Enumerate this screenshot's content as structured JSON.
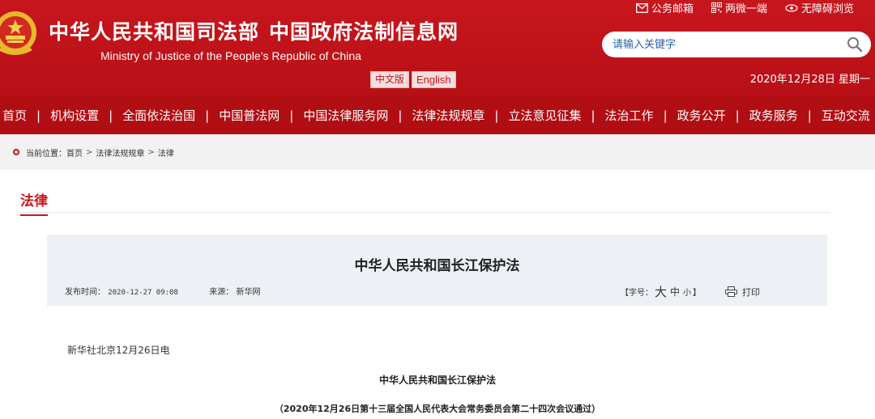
{
  "header": {
    "title_cn_1": "中华人民共和国司法部",
    "title_cn_2": "中国政府法制信息网",
    "subtitle_en": "Ministry of Justice of the People’s Republic of China",
    "lang_cn": "中文版",
    "lang_en": "English",
    "date_text": "2020年12月28日 星期一",
    "top_links": [
      {
        "label": "公务邮箱",
        "icon": "mail-icon"
      },
      {
        "label": "两微一端",
        "icon": "qr-code-icon"
      },
      {
        "label": "无障碍浏览",
        "icon": "eye-icon"
      }
    ]
  },
  "search": {
    "placeholder": "请输入关键字",
    "icon": "search-icon"
  },
  "nav": {
    "items": [
      "首页",
      "机构设置",
      "全面依法治国",
      "中国普法网",
      "中国法律服务网",
      "法律法规规章",
      "立法意见征集",
      "法治工作",
      "政务公开",
      "政务服务",
      "互动交流"
    ]
  },
  "breadcrumb": {
    "prefix": "当前位置：",
    "items": [
      "首页",
      "法律法规规章",
      "法律"
    ],
    "separator": ">"
  },
  "section": {
    "title": "法律"
  },
  "article": {
    "title": "中华人民共和国长江保护法",
    "publish_label": "发布时间：",
    "publish_time": "2020-12-27 09:08",
    "source_label": "来源：",
    "source": "新华网",
    "font_size_label": "【字号：",
    "font_size_end": "】",
    "font_big": "大",
    "font_mid": "中",
    "font_small": "小",
    "print_label": "打印"
  },
  "content": {
    "dateline": "新华社北京12月26日电",
    "title": "中华人民共和国长江保护法",
    "subtitle": "（2020年12月26日第十三届全国人民代表大会常务委员会第二十四次会议通过）"
  },
  "colors": {
    "brand_red": "#c8161d",
    "nav_red": "#b10e14",
    "card_bg": "#edf0f4",
    "search_text": "#2a5fa8"
  }
}
